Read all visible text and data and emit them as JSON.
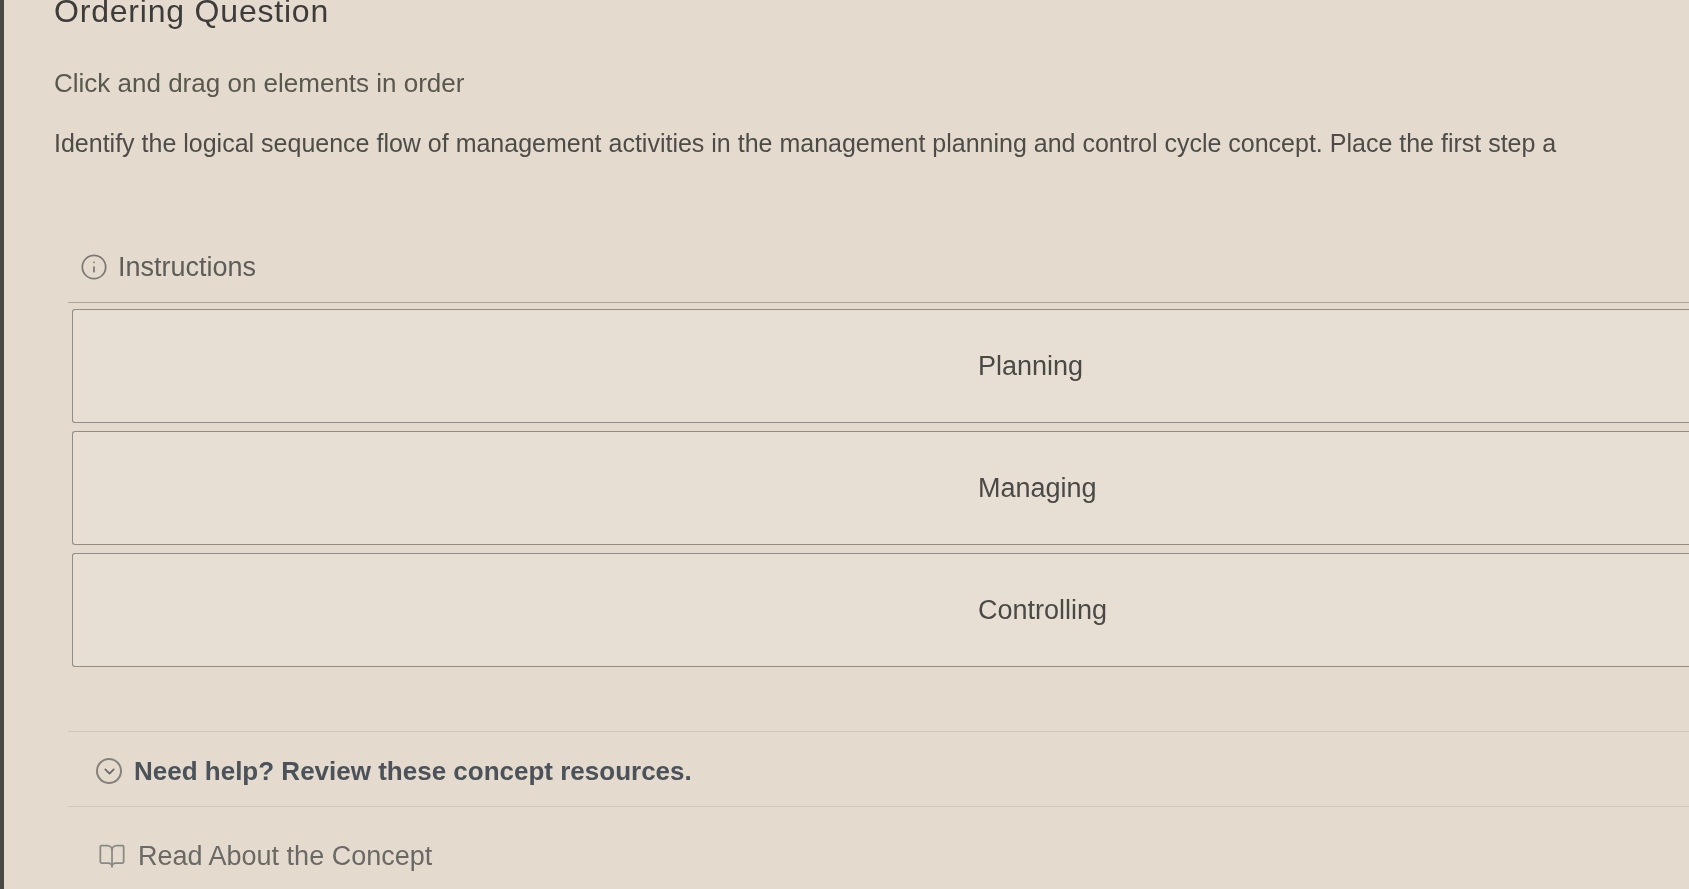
{
  "header": {
    "title": "Ordering Question",
    "instruction": "Click and drag on elements in order"
  },
  "question": {
    "text": "Identify the logical sequence flow of management activities in the management planning and control cycle concept. Place the first step a"
  },
  "instructions": {
    "label": "Instructions"
  },
  "items": [
    {
      "label": "Planning"
    },
    {
      "label": "Managing"
    },
    {
      "label": "Controlling"
    }
  ],
  "help": {
    "label": "Need help? Review these concept resources."
  },
  "resources": [
    {
      "label": "Read About the Concept"
    }
  ]
}
